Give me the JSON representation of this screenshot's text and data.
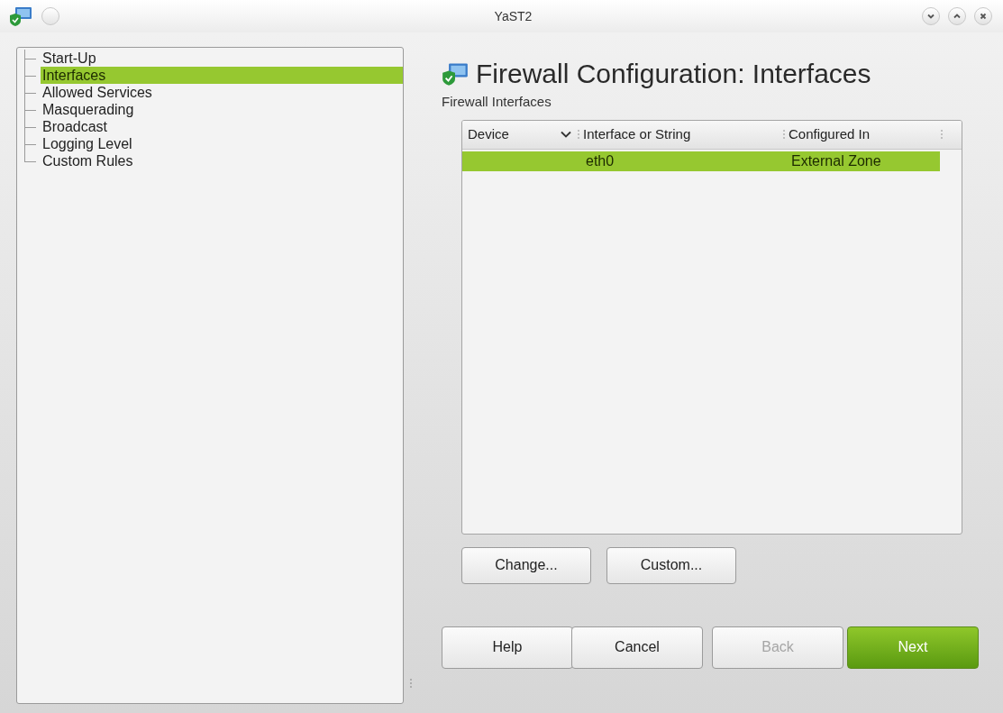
{
  "window": {
    "title": "YaST2"
  },
  "sidebar": {
    "items": [
      {
        "label": "Start-Up",
        "selected": false
      },
      {
        "label": "Interfaces",
        "selected": true
      },
      {
        "label": "Allowed Services",
        "selected": false
      },
      {
        "label": "Masquerading",
        "selected": false
      },
      {
        "label": "Broadcast",
        "selected": false
      },
      {
        "label": "Logging Level",
        "selected": false
      },
      {
        "label": "Custom Rules",
        "selected": false
      }
    ]
  },
  "page": {
    "title": "Firewall Configuration: Interfaces",
    "subtitle": "Firewall Interfaces"
  },
  "table": {
    "columns": [
      {
        "label": "Device",
        "sorted": true
      },
      {
        "label": "Interface or String",
        "sorted": false
      },
      {
        "label": "Configured In",
        "sorted": false
      }
    ],
    "rows": [
      {
        "cells": [
          "",
          "eth0",
          "External Zone"
        ],
        "selected": true
      }
    ]
  },
  "table_buttons": [
    {
      "label": "Change...",
      "disabled": false
    },
    {
      "label": "Custom...",
      "disabled": false
    }
  ],
  "dialog_buttons": [
    {
      "label": "Help",
      "disabled": false,
      "kind": "normal"
    },
    {
      "label": "Cancel",
      "disabled": false,
      "kind": "normal"
    },
    {
      "label": "Back",
      "disabled": true,
      "kind": "normal"
    },
    {
      "label": "Next",
      "disabled": false,
      "kind": "primary"
    }
  ]
}
